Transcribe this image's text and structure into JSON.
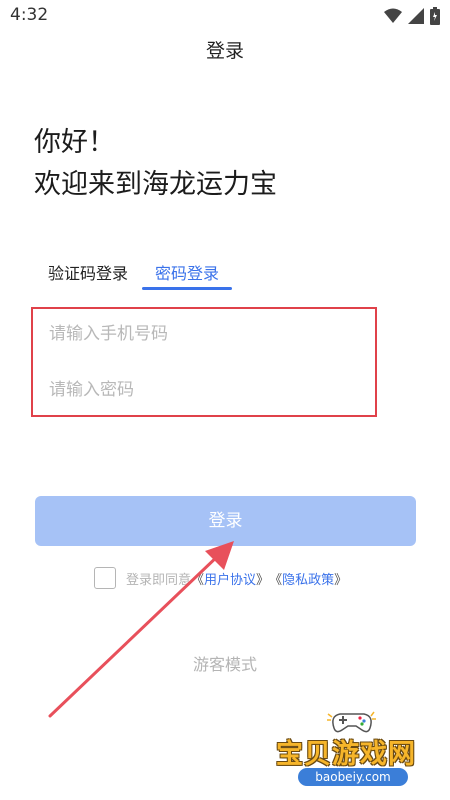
{
  "status_bar": {
    "time": "4:32"
  },
  "header": {
    "title": "登录"
  },
  "greeting": {
    "line1": "你好！",
    "line2": "欢迎来到海龙运力宝"
  },
  "tabs": [
    {
      "label": "验证码登录",
      "active": false
    },
    {
      "label": "密码登录",
      "active": true
    }
  ],
  "form": {
    "phone_placeholder": "请输入手机号码",
    "password_placeholder": "请输入密码"
  },
  "login_button": {
    "label": "登录"
  },
  "agreement": {
    "prefix": "登录即同意",
    "open_bracket_1": "《",
    "user_agreement": "用户协议",
    "close_bracket_1": "》",
    "open_bracket_2": "《",
    "privacy_policy": "隐私政策",
    "close_bracket_2": "》",
    "checked": false
  },
  "guest_mode": {
    "label": "游客模式"
  },
  "watermark": {
    "text": "宝贝游戏网",
    "domain": "baobeiy.com"
  },
  "colors": {
    "accent": "#3a72ea",
    "button_disabled": "#a6c2f6",
    "highlight_box": "#e0414a",
    "placeholder": "#b8b8b8"
  },
  "icons": [
    "wifi-icon",
    "signal-icon",
    "battery-icon",
    "checkbox-icon",
    "arrow-annotation-icon",
    "gamepad-icon"
  ]
}
